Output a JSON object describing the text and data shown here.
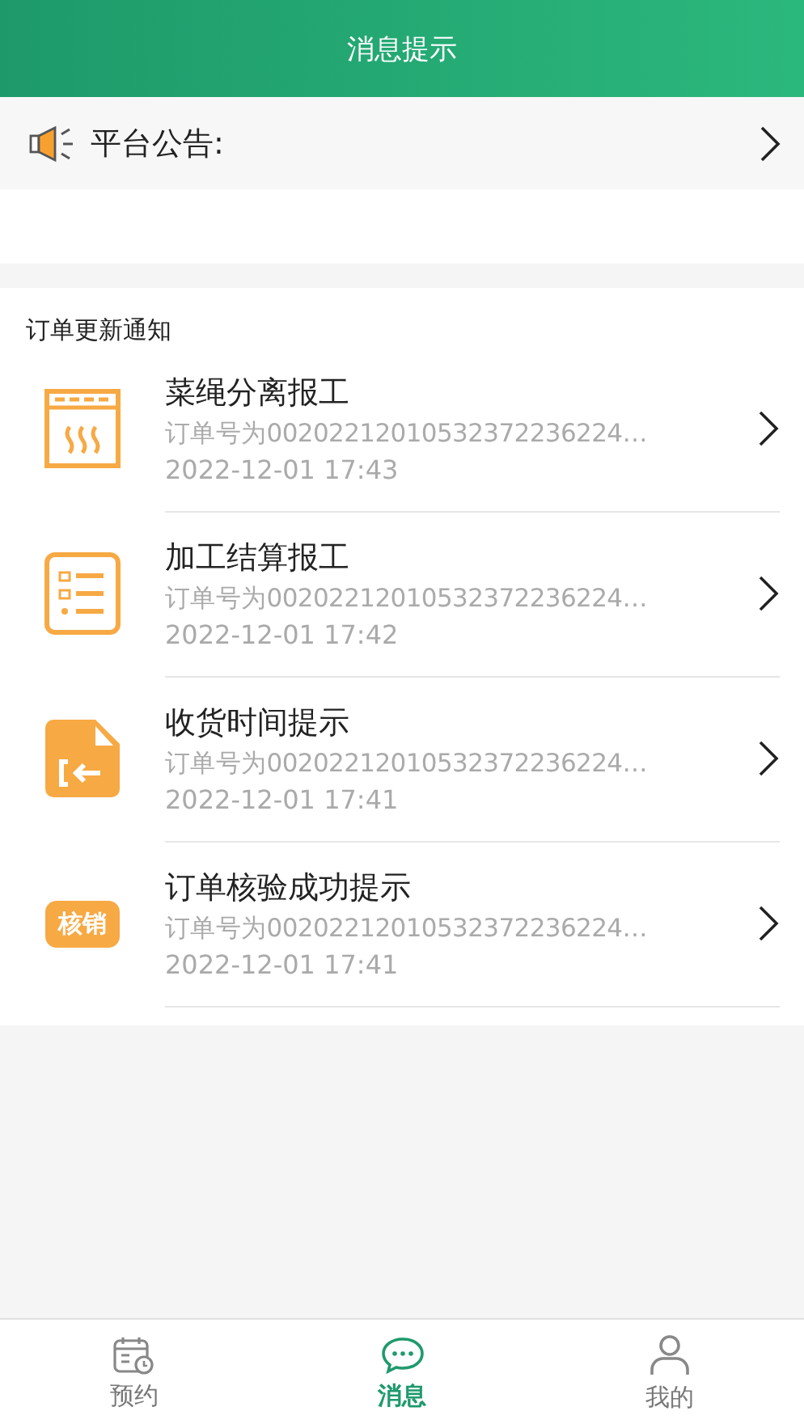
{
  "header": {
    "title": "消息提示"
  },
  "announcement": {
    "label": "平台公告:"
  },
  "section": {
    "title": "订单更新通知"
  },
  "notifications": [
    {
      "kind": "oven",
      "title": "菜绳分离报工",
      "detail": "订单号为00202212010532372236224…",
      "time": "2022-12-01 17:43"
    },
    {
      "kind": "checklist",
      "title": "加工结算报工",
      "detail": "订单号为00202212010532372236224…",
      "time": "2022-12-01 17:42"
    },
    {
      "kind": "file",
      "title": "收货时间提示",
      "detail": "订单号为00202212010532372236224…",
      "time": "2022-12-01 17:41"
    },
    {
      "kind": "badge",
      "icon_text": "核销",
      "title": "订单核验成功提示",
      "detail": "订单号为00202212010532372236224…",
      "time": "2022-12-01 17:41"
    }
  ],
  "tabs": [
    {
      "kind": "calendar",
      "label": "预约",
      "selected": false
    },
    {
      "kind": "chat",
      "label": "消息",
      "selected": true
    },
    {
      "kind": "person",
      "label": "我的",
      "selected": false
    }
  ]
}
